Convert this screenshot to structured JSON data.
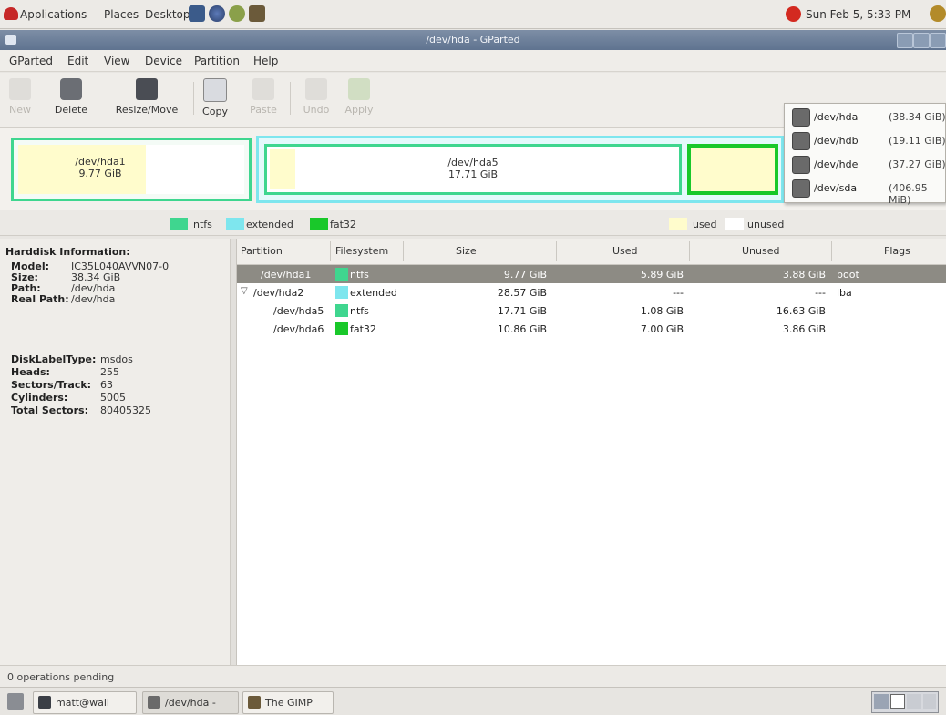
{
  "panel": {
    "menus": [
      "Applications",
      "Places",
      "Desktop"
    ],
    "clock": "Sun Feb 5, 5:33 PM"
  },
  "window": {
    "title": "/dev/hda - GParted"
  },
  "menubar": [
    "GParted",
    "Edit",
    "View",
    "Device",
    "Partition",
    "Help"
  ],
  "toolbar": {
    "new": "New",
    "delete": "Delete",
    "resize": "Resize/Move",
    "copy": "Copy",
    "paste": "Paste",
    "undo": "Undo",
    "apply": "Apply"
  },
  "visual": {
    "p1": {
      "name": "/dev/hda1",
      "size": "9.77 GiB"
    },
    "p5": {
      "name": "/dev/hda5",
      "size": "17.71 GiB"
    }
  },
  "legend": {
    "ntfs": "ntfs",
    "extended": "extended",
    "fat32": "fat32",
    "used": "used",
    "unused": "unused"
  },
  "colors": {
    "ntfs": "#3fd68f",
    "extended": "#7ee6ee",
    "fat32": "#19c82a",
    "used": "#fffccc",
    "selected": "#8d8b84"
  },
  "devices": [
    {
      "path": "/dev/hda",
      "size": "(38.34 GiB)"
    },
    {
      "path": "/dev/hdb",
      "size": "(19.11 GiB)"
    },
    {
      "path": "/dev/hde",
      "size": "(37.27 GiB)"
    },
    {
      "path": "/dev/sda",
      "size": "(406.95 MiB)"
    }
  ],
  "info": {
    "heading": "Harddisk Information:",
    "model_label": "Model:",
    "model": "IC35L040AVVN07-0",
    "size_label": "Size:",
    "size": "38.34 GiB",
    "path_label": "Path:",
    "path": "/dev/hda",
    "real_path_label": "Real Path:",
    "real_path": "/dev/hda",
    "disklabel_label": "DiskLabelType:",
    "disklabel": "msdos",
    "heads_label": "Heads:",
    "heads": "255",
    "sectors_label": "Sectors/Track:",
    "sectors": "63",
    "cylinders_label": "Cylinders:",
    "cylinders": "5005",
    "total_label": "Total Sectors:",
    "total": "80405325"
  },
  "table": {
    "headers": [
      "Partition",
      "Filesystem",
      "Size",
      "Used",
      "Unused",
      "Flags"
    ],
    "rows": [
      {
        "partition": "/dev/hda1",
        "filesystem": "ntfs",
        "size": "9.77 GiB",
        "used": "5.89 GiB",
        "unused": "3.88 GiB",
        "flags": "boot"
      },
      {
        "partition": "/dev/hda2",
        "filesystem": "extended",
        "size": "28.57 GiB",
        "used": "---",
        "unused": "---",
        "flags": "lba"
      },
      {
        "partition": "/dev/hda5",
        "filesystem": "ntfs",
        "size": "17.71 GiB",
        "used": "1.08 GiB",
        "unused": "16.63 GiB",
        "flags": ""
      },
      {
        "partition": "/dev/hda6",
        "filesystem": "fat32",
        "size": "10.86 GiB",
        "used": "7.00 GiB",
        "unused": "3.86 GiB",
        "flags": ""
      }
    ]
  },
  "status": "0 operations pending",
  "taskbar": [
    "matt@wall",
    "/dev/hda -",
    "The GIMP"
  ]
}
